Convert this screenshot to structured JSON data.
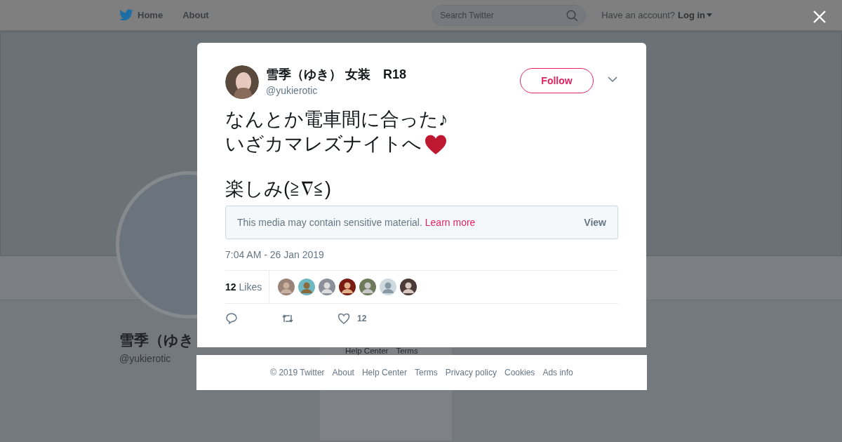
{
  "top_bar": {
    "nav": [
      {
        "label": "Home",
        "kind": "logo"
      },
      {
        "label": "About",
        "kind": "plain"
      }
    ],
    "search": {
      "placeholder": "Search Twitter"
    },
    "account_prompt": "Have an account?",
    "login": "Log in"
  },
  "background_profile": {
    "name": "雪季（ゆき",
    "handle": "@yukierotic",
    "links": [
      "Help Center",
      "Terms"
    ]
  },
  "tweet": {
    "author": {
      "name": "雪季（ゆき） 女装　R18",
      "handle": "@yukierotic"
    },
    "follow": "Follow",
    "paragraphs": [
      {
        "lines": [
          {
            "text": "なんとか電車間に合った♪"
          },
          {
            "text": "いざカマレズナイトへ",
            "kind": "text_heart"
          }
        ]
      },
      {
        "lines": [
          {
            "text": "楽しみ(≧∇≦)"
          }
        ]
      }
    ],
    "sensitive_notice": {
      "text": "This media may contain sensitive material.",
      "link": "Learn more",
      "action": "View"
    },
    "timestamp": "7:04 AM - 26 Jan 2019",
    "likes": {
      "count": "12",
      "label": "Likes",
      "avatars": [
        {
          "kind": "photo"
        },
        {
          "kind": "photo"
        },
        {
          "kind": "photo"
        },
        {
          "kind": "photo"
        },
        {
          "kind": "photo"
        },
        {
          "kind": "default"
        },
        {
          "kind": "photo"
        }
      ]
    },
    "actions": [
      {
        "kind": "reply"
      },
      {
        "kind": "retweet"
      },
      {
        "kind": "like",
        "count": "12"
      }
    ]
  },
  "footer": [
    "© 2019 Twitter",
    "About",
    "Help Center",
    "Terms",
    "Privacy policy",
    "Cookies",
    "Ads info"
  ]
}
